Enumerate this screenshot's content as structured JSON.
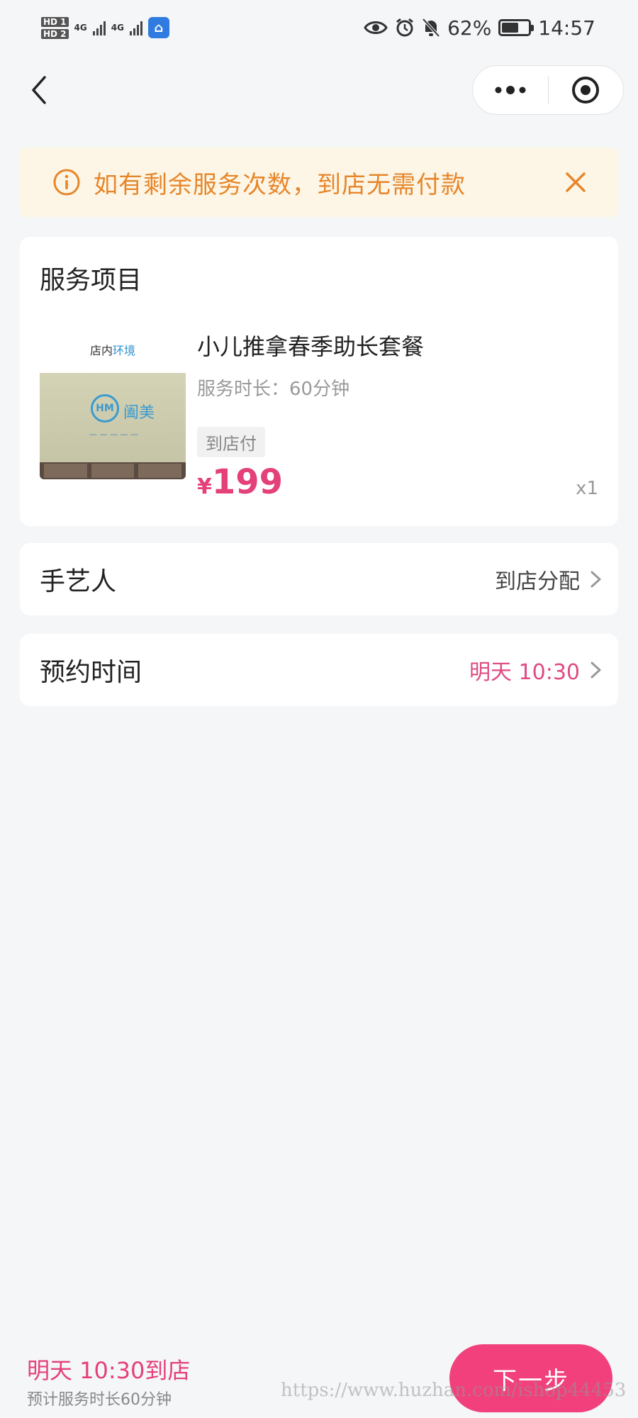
{
  "status_bar": {
    "sim1_badge": "HD 1",
    "sim2_badge": "HD 2",
    "net1": "4G",
    "net2": "4G",
    "battery_percent": "62%",
    "battery_level": 0.62,
    "time": "14:57",
    "icons": [
      "eye-icon",
      "alarm-icon",
      "mute-bell-icon"
    ]
  },
  "nav": {
    "back_icon": "chevron-left-icon",
    "more_icon": "more-dots-icon",
    "target_icon": "target-icon"
  },
  "notice": {
    "text": "如有剩余服务次数，到店无需付款",
    "color": "#e6862a",
    "background": "#fdf6e6"
  },
  "service": {
    "section_title": "服务项目",
    "thumb_caption_plain": "店内",
    "thumb_caption_highlight": "环境",
    "thumb_logo_text": "阖美",
    "name": "小儿推拿春季助长套餐",
    "duration": "服务时长：60分钟",
    "payment_tag": "到店付",
    "currency": "¥",
    "price": "199",
    "quantity": "x1"
  },
  "artisan": {
    "label": "手艺人",
    "value": "到店分配"
  },
  "appointment": {
    "label": "预约时间",
    "value": "明天 10:30",
    "accent": "#e04a82"
  },
  "footer": {
    "arrive_text": "明天 10:30到店",
    "estimate_text": "预计服务时长60分钟",
    "next_button": "下一步",
    "watermark": "https://www.huzhan.com/ishop44453",
    "button_color": "#f1407c"
  }
}
